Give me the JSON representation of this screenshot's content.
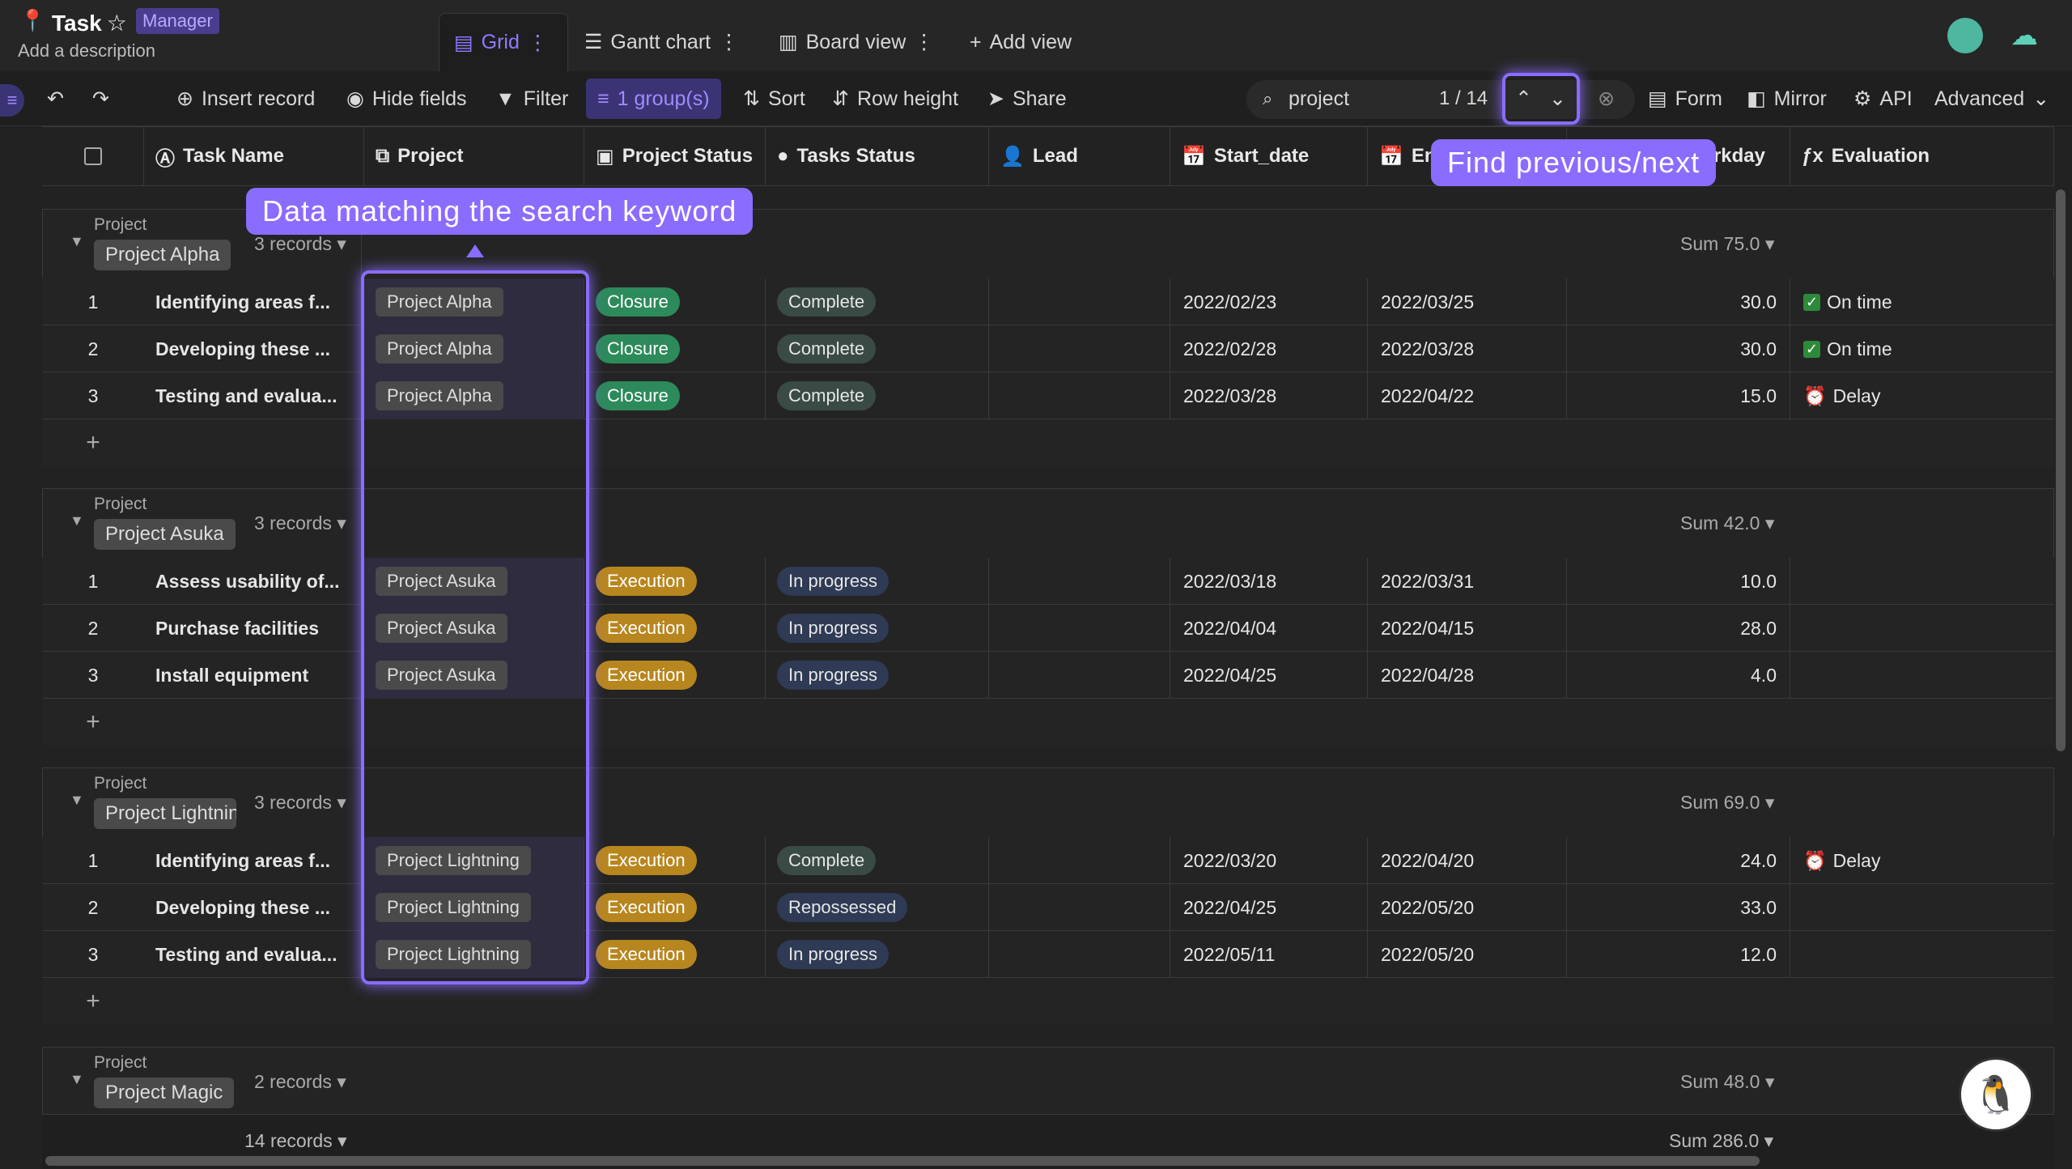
{
  "app": {
    "title": "Task",
    "badge": "Manager",
    "description": "Add a description"
  },
  "views": [
    {
      "label": "Grid"
    },
    {
      "label": "Gantt chart"
    },
    {
      "label": "Board view"
    },
    {
      "label": "Add view"
    }
  ],
  "toolbar": {
    "insert": "Insert record",
    "hide": "Hide fields",
    "filter": "Filter",
    "group": "1 group(s)",
    "sort": "Sort",
    "row_height": "Row height",
    "share": "Share",
    "form": "Form",
    "mirror": "Mirror",
    "api": "API",
    "advanced": "Advanced"
  },
  "search": {
    "value": "project",
    "count": "1 / 14"
  },
  "columns": [
    "Task Name",
    "Project",
    "Project Status",
    "Tasks Status",
    "Lead",
    "Start_date",
    "En",
    "rkday",
    "Evaluation"
  ],
  "callouts": {
    "search": "Data matching the search keyword",
    "nav": "Find previous/next"
  },
  "group_label": "Project",
  "groups": [
    {
      "name": "Project Alpha",
      "records": "3 records",
      "sum": "Sum 75.0",
      "rows": [
        {
          "n": "1",
          "task": "Identifying areas f...",
          "project": "Project Alpha",
          "pstatus": "Closure",
          "tstatus": "Complete",
          "start": "2022/02/23",
          "end": "2022/03/25",
          "wd": "30.0",
          "eval": "On time",
          "evalicon": "check"
        },
        {
          "n": "2",
          "task": "Developing these ...",
          "project": "Project Alpha",
          "pstatus": "Closure",
          "tstatus": "Complete",
          "start": "2022/02/28",
          "end": "2022/03/28",
          "wd": "30.0",
          "eval": "On time",
          "evalicon": "check"
        },
        {
          "n": "3",
          "task": "Testing and evalua...",
          "project": "Project Alpha",
          "pstatus": "Closure",
          "tstatus": "Complete",
          "start": "2022/03/28",
          "end": "2022/04/22",
          "wd": "15.0",
          "eval": "Delay",
          "evalicon": "alarm"
        }
      ]
    },
    {
      "name": "Project Asuka",
      "records": "3 records",
      "sum": "Sum 42.0",
      "rows": [
        {
          "n": "1",
          "task": "Assess usability of...",
          "project": "Project Asuka",
          "pstatus": "Execution",
          "tstatus": "In progress",
          "start": "2022/03/18",
          "end": "2022/03/31",
          "wd": "10.0",
          "eval": "",
          "evalicon": ""
        },
        {
          "n": "2",
          "task": "Purchase facilities",
          "project": "Project Asuka",
          "pstatus": "Execution",
          "tstatus": "In progress",
          "start": "2022/04/04",
          "end": "2022/04/15",
          "wd": "28.0",
          "eval": "",
          "evalicon": ""
        },
        {
          "n": "3",
          "task": "Install equipment",
          "project": "Project Asuka",
          "pstatus": "Execution",
          "tstatus": "In progress",
          "start": "2022/04/25",
          "end": "2022/04/28",
          "wd": "4.0",
          "eval": "",
          "evalicon": ""
        }
      ]
    },
    {
      "name": "Project Lightning",
      "records": "3 records",
      "sum": "Sum 69.0",
      "rows": [
        {
          "n": "1",
          "task": "Identifying areas f...",
          "project": "Project Lightning",
          "pstatus": "Execution",
          "tstatus": "Complete",
          "start": "2022/03/20",
          "end": "2022/04/20",
          "wd": "24.0",
          "eval": "Delay",
          "evalicon": "alarm"
        },
        {
          "n": "2",
          "task": "Developing these ...",
          "project": "Project Lightning",
          "pstatus": "Execution",
          "tstatus": "Repossessed",
          "start": "2022/04/25",
          "end": "2022/05/20",
          "wd": "33.0",
          "eval": "",
          "evalicon": ""
        },
        {
          "n": "3",
          "task": "Testing and evalua...",
          "project": "Project Lightning",
          "pstatus": "Execution",
          "tstatus": "In progress",
          "start": "2022/05/11",
          "end": "2022/05/20",
          "wd": "12.0",
          "eval": "",
          "evalicon": ""
        }
      ]
    },
    {
      "name": "Project Magic",
      "records": "2 records",
      "sum": "Sum 48.0",
      "rows": []
    }
  ],
  "footer": {
    "records": "14 records",
    "sum": "Sum 286.0"
  }
}
